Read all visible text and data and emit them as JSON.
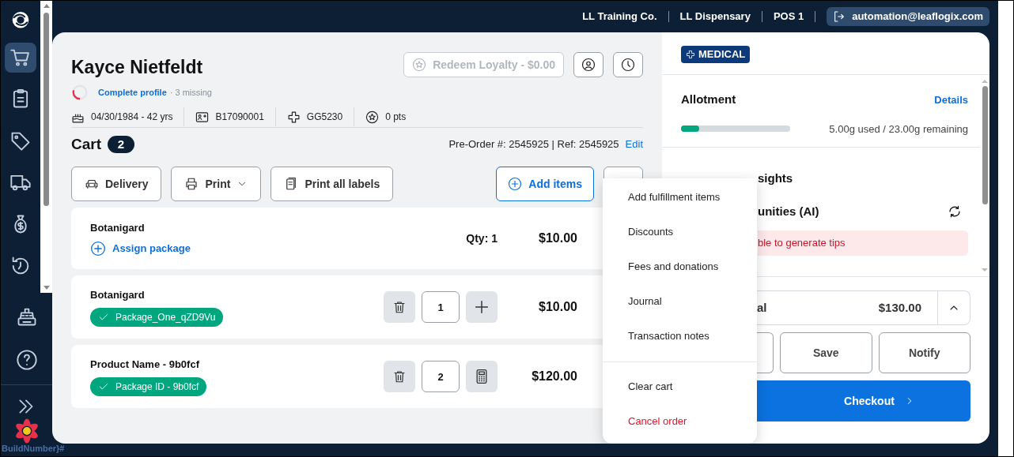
{
  "sidebar": {
    "items": [
      {
        "kind": "cart",
        "selected": true
      },
      {
        "kind": "clipboard",
        "selected": false
      },
      {
        "kind": "tag",
        "selected": false
      },
      {
        "kind": "truck",
        "selected": false
      },
      {
        "kind": "moneybag",
        "selected": false
      },
      {
        "kind": "history",
        "selected": false
      },
      {
        "kind": "register",
        "selected": false
      },
      {
        "kind": "help",
        "selected": false
      }
    ]
  },
  "build_label": "BuildNumber}#",
  "top_bar": {
    "locations": [
      "LL Training Co.",
      "LL Dispensary",
      "POS 1"
    ],
    "user": "automation@leaflogix.com"
  },
  "customer": {
    "name": "Kayce Nietfeldt",
    "loyalty_button": "Redeem Loyalty - $0.00",
    "loyalty_disabled": true,
    "profile": {
      "link": "Complete profile",
      "note": "· 3 missing",
      "level": 0.3
    },
    "details": [
      {
        "kind": "birthday",
        "text": "04/30/1984 - 42 yrs"
      },
      {
        "kind": "id",
        "text": "B17090001"
      },
      {
        "kind": "medical",
        "text": "GG5230"
      },
      {
        "kind": "points",
        "text": "0 pts"
      }
    ]
  },
  "cart": {
    "title": "Cart",
    "count": "2",
    "order_ref": "Pre-Order #: 2545925 | Ref: 2545925",
    "edit": "Edit",
    "actions": [
      {
        "kind": "delivery",
        "label": "Delivery"
      },
      {
        "kind": "print",
        "label": "Print"
      },
      {
        "kind": "labels",
        "label": "Print all labels"
      }
    ],
    "add_items": "Add items",
    "items": [
      {
        "kind": "unassigned",
        "name": "Botanigard",
        "assign": "Assign package",
        "qty_label": "Qty: 1",
        "price": "$10.00"
      },
      {
        "kind": "assigned",
        "name": "Botanigard",
        "tag": "Package_One_qZD9Vu",
        "controls": [
          {
            "kind": "delete"
          },
          {
            "kind": "quantity",
            "value": "1"
          },
          {
            "kind": "plus"
          }
        ],
        "price": "$10.00"
      },
      {
        "kind": "assigned",
        "name": "Product Name - 9b0fcf",
        "tag": "Package ID - 9b0fcf",
        "controls": [
          {
            "kind": "delete"
          },
          {
            "kind": "quantity",
            "value": "2"
          },
          {
            "kind": "calculator"
          }
        ],
        "price": "$120.00"
      }
    ]
  },
  "menu": {
    "groups": [
      [
        {
          "label": "Add fulfillment items",
          "danger": false
        },
        {
          "label": "Discounts",
          "danger": false
        },
        {
          "label": "Fees and donations",
          "danger": false
        },
        {
          "label": "Journal",
          "danger": false
        },
        {
          "label": "Transaction notes",
          "danger": false
        }
      ],
      [
        {
          "label": "Clear cart",
          "danger": false
        },
        {
          "label": "Cancel order",
          "danger": true
        }
      ]
    ]
  },
  "summary": {
    "badge": "MEDICAL",
    "allotment": {
      "title": "Allotment",
      "details": "Details",
      "level": 0.17,
      "reading": "5.00g used / 23.00g remaining"
    },
    "insights": {
      "title": "sights",
      "subtitle": "unities (AI)",
      "error": "ble to generate tips"
    },
    "subtotal": {
      "label": "al",
      "amount": "$130.00"
    },
    "buttons": [
      "Save",
      "Notify"
    ],
    "checkout": "Checkout"
  }
}
